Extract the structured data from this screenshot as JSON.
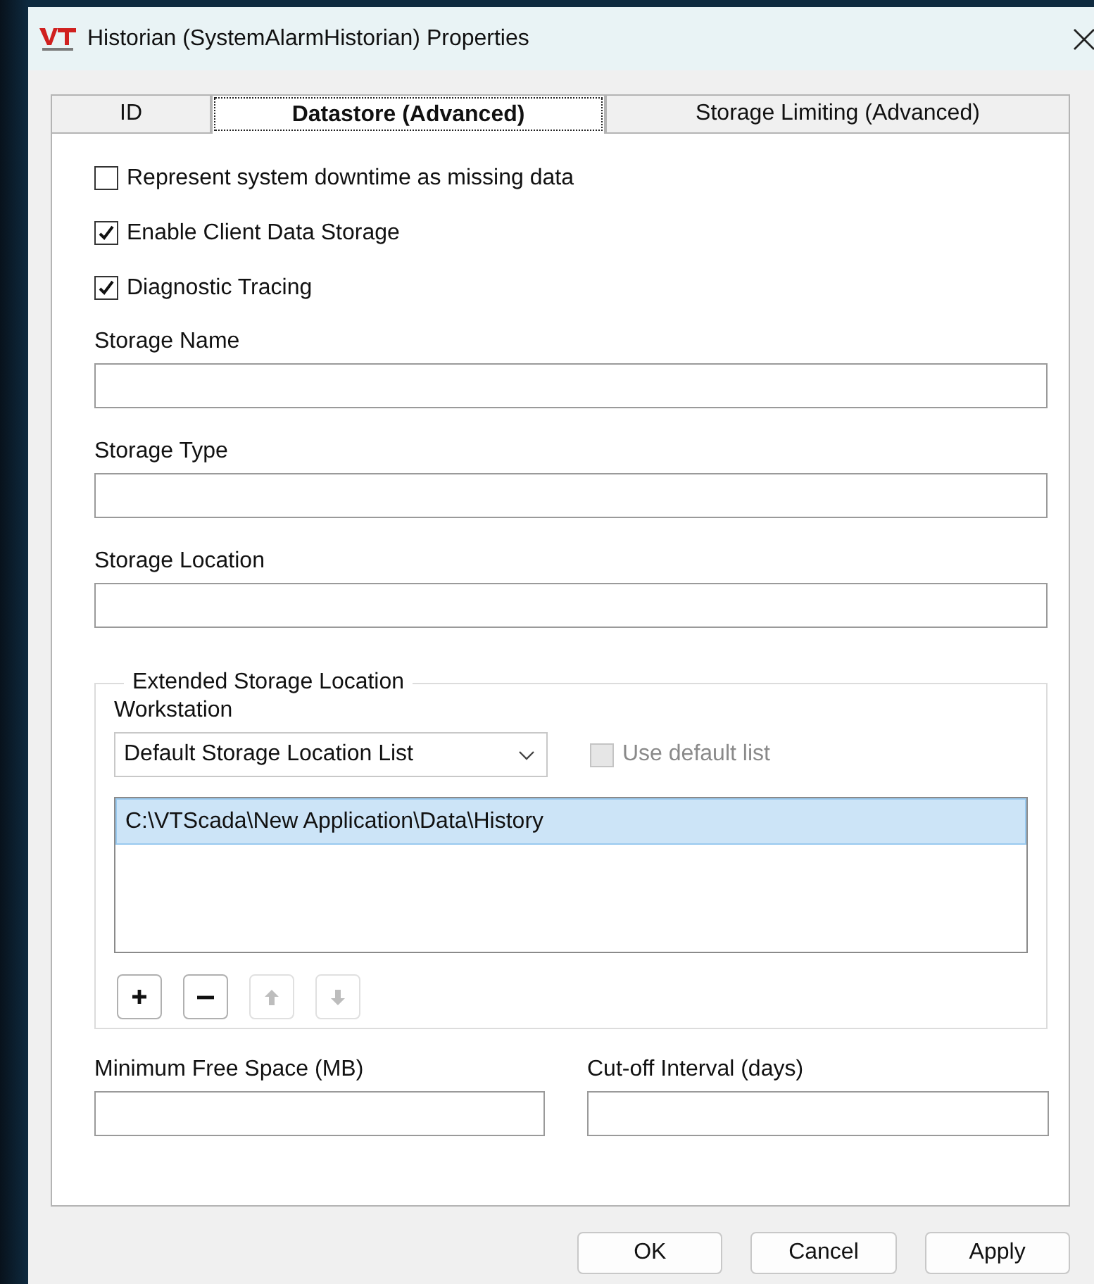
{
  "window": {
    "title": "Historian (SystemAlarmHistorian) Properties"
  },
  "tabs": [
    {
      "label": "ID",
      "selected": false
    },
    {
      "label": "Datastore (Advanced)",
      "selected": true
    },
    {
      "label": "Storage Limiting (Advanced)",
      "selected": false
    }
  ],
  "options": [
    {
      "label": "Represent system downtime as missing data",
      "checked": false
    },
    {
      "label": "Enable Client Data Storage",
      "checked": true
    },
    {
      "label": "Diagnostic Tracing",
      "checked": true
    }
  ],
  "fields": [
    {
      "label": "Storage Name"
    },
    {
      "label": "Storage Type"
    },
    {
      "label": "Storage Location"
    }
  ],
  "extended_storage": {
    "title": "Extended Storage Location",
    "workstation_label": "Workstation",
    "workstation": "Default Storage Location List",
    "use_default": {
      "label": "Use default list",
      "checked": false,
      "disabled": true
    },
    "locations": [
      {
        "path": "C:\\VTScada\\New Application\\Data\\History",
        "selected": true
      }
    ],
    "list_buttons": [
      {
        "kind": "add",
        "disabled": false
      },
      {
        "kind": "remove",
        "disabled": false
      },
      {
        "kind": "move-up",
        "disabled": true
      },
      {
        "kind": "move-down",
        "disabled": true
      }
    ]
  },
  "bottom_fields": [
    {
      "label": "Minimum Free Space (MB)"
    },
    {
      "label": "Cut-off Interval (days)"
    }
  ],
  "buttons": [
    "OK",
    "Cancel",
    "Apply"
  ]
}
